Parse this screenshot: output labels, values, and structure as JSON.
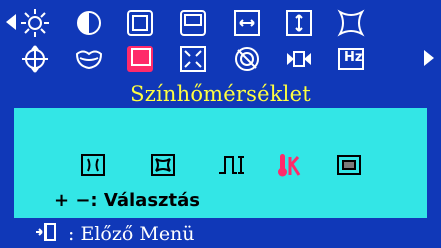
{
  "title": "Színhőmérséklet",
  "hint": {
    "keys": "+ −:",
    "label": "Választás"
  },
  "footer": {
    "label": ": Előző Menü"
  },
  "colors": {
    "background": "#1038b8",
    "panel": "#33e6e6",
    "title": "#ffff40",
    "selected": "#ff2a6a"
  },
  "icons": {
    "row1": [
      "brightness-icon",
      "contrast-icon",
      "image-size-icon",
      "image-position-icon",
      "h-size-icon",
      "v-size-icon",
      "pincushion-icon"
    ],
    "row2": [
      "position-icon",
      "color-icon",
      "color-temperature-icon",
      "zoom-icon",
      "degauss-icon",
      "moire-icon",
      "hz-icon"
    ],
    "sub": [
      "sub-icon-1",
      "sub-icon-2",
      "sub-icon-3",
      "color-temp-k-icon",
      "sub-icon-5"
    ]
  },
  "hz_label": "Hz"
}
